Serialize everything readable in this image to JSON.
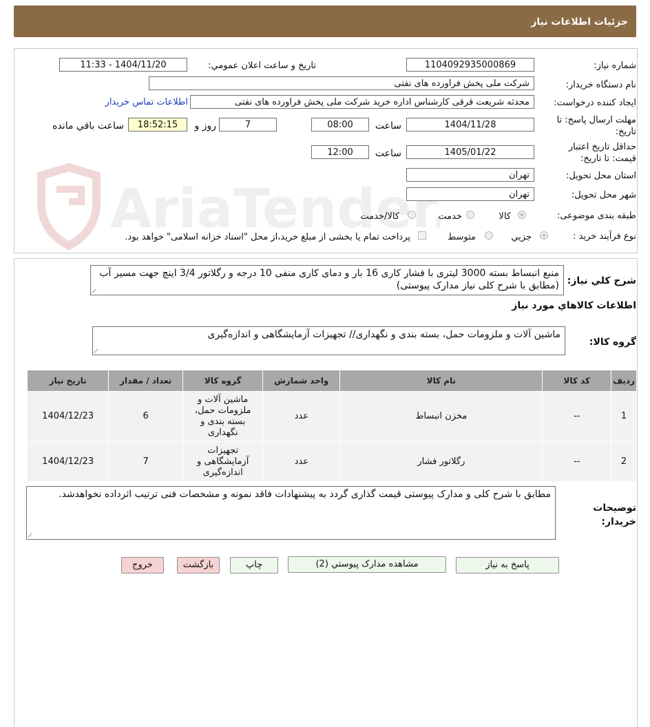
{
  "header": {
    "title": "جزئيات اطلاعات نياز"
  },
  "fields": {
    "need_number_label": "شماره نياز:",
    "need_number": "1104092935000869",
    "announce_label": "تاريخ و ساعت اعلان عمومي:",
    "announce_value": "1404/11/20 - 11:33",
    "buyer_org_label": "نام دستگاه خريدار:",
    "buyer_org": "شرکت ملی پخش فراورده های نفتی",
    "requester_label": "ايجاد کننده درخواست:",
    "requester": "محدثه شریعت قرقی کارشناس اداره خرید  شرکت ملی پخش فراورده های نفتی",
    "contact_link": "اطلاعات تماس خريدار",
    "deadline_label": "مهلت ارسال پاسخ: تا تاريخ:",
    "deadline_date": "1404/11/28",
    "time_label": "ساعت",
    "deadline_time": "08:00",
    "days_value": "7",
    "days_and_label": "روز و",
    "remaining_time": "18:52:15",
    "remaining_label": "ساعت باقي مانده",
    "validity_label": "حداقل تاريخ اعتبار قيمت: تا تاريخ:",
    "validity_date": "1405/01/22",
    "validity_time": "12:00",
    "province_label": "استان محل تحويل:",
    "province": "تهران",
    "city_label": "شهر محل تحويل:",
    "city": "تهران",
    "category_label": "طبقه بندی موضوعی:",
    "category_options": [
      "کالا",
      "خدمت",
      "کالا/خدمت"
    ],
    "process_label": "نوع فرآيند خريد :",
    "process_options": [
      "جزيي",
      "متوسط"
    ],
    "payment_note": "پرداخت تمام یا بخشی از مبلغ خرید،از محل \"اسناد خزانه اسلامی\" خواهد بود."
  },
  "description": {
    "label": "شرح کلي نياز:",
    "text": "منبع انبساط بسته 3000 لیتری با فشار کاری 16 بار و دمای کاری منفی 10 درجه و رگلاتور 3/4 اینچ جهت مسیر آب (مطابق با شرح کلی نیاز مدارک پیوستی)"
  },
  "goods_section": {
    "title": "اطلاعات کالاهاي مورد نياز",
    "group_label": "گروه کالا:",
    "group_text": "ماشین آلات و ملزومات حمل، بسته بندی و نگهداری// تجهیزات آزمایشگاهی و اندازه‌گیری"
  },
  "table": {
    "headers": [
      "رديف",
      "کد کالا",
      "نام کالا",
      "واحد شمارش",
      "گروه کالا",
      "تعداد / مقدار",
      "تاريخ نياز"
    ],
    "rows": [
      [
        "1",
        "--",
        "مخزن انبساط",
        "عدد",
        "ماشین آلات و ملزومات حمل، بسته بندی و نگهداری",
        "6",
        "1404/12/23"
      ],
      [
        "2",
        "--",
        "رگلاتور فشار",
        "عدد",
        "تجهیزات آزمایشگاهی و اندازه‌گیری",
        "7",
        "1404/12/23"
      ]
    ]
  },
  "buyer_notes": {
    "label": "توضيحات خريدار:",
    "text": "مطابق با شرح کلی و مدارک پیوستی قیمت گذاری گردد به پیشنهادات فاقد نمونه و مشخصات فنی ترتیب اثرداده نخواهدشد."
  },
  "buttons": {
    "reply": "پاسخ به نياز",
    "attachments": "مشاهده مدارک پيوستي (2)",
    "print": "چاپ",
    "back": "بازگشت",
    "exit": "خروج"
  },
  "colors": {
    "header_bg": "#8a6b45",
    "button_bg": "#eef7ec",
    "button_pink": "#f6d3d3",
    "link": "#1a3fbf"
  }
}
